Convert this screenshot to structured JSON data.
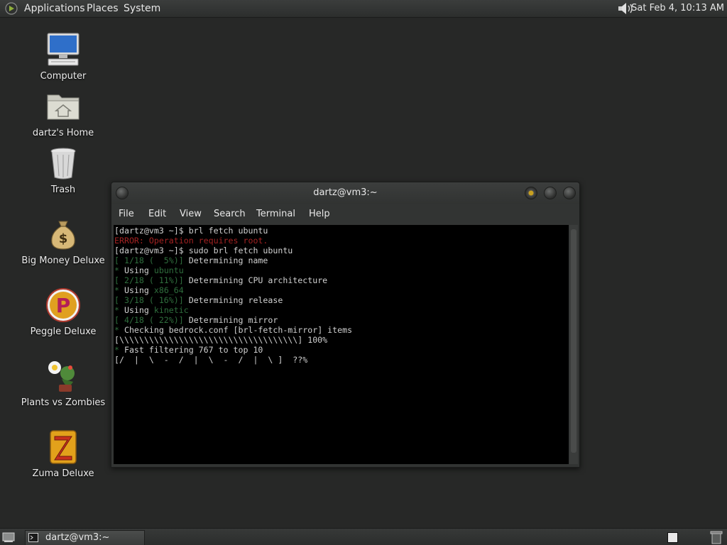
{
  "top_panel": {
    "menus": [
      "Applications",
      "Places",
      "System"
    ],
    "clock": "Sat Feb  4, 10:13 AM"
  },
  "desktop_icons": [
    {
      "label": "Computer",
      "icon": "computer-icon"
    },
    {
      "label": "dartz's Home",
      "icon": "home-folder-icon"
    },
    {
      "label": "Trash",
      "icon": "trash-icon"
    },
    {
      "label": "Big Money Deluxe",
      "icon": "money-bag-icon"
    },
    {
      "label": "Peggle Deluxe",
      "icon": "peggle-icon"
    },
    {
      "label": "Plants vs Zombies",
      "icon": "plants-vs-zombies-icon"
    },
    {
      "label": "Zuma Deluxe",
      "icon": "zuma-icon"
    }
  ],
  "terminal": {
    "title": "dartz@vm3:~",
    "menu": [
      "File",
      "Edit",
      "View",
      "Search",
      "Terminal",
      "Help"
    ],
    "lines": [
      [
        {
          "t": "[dartz@vm3 ~]$ brl fetch ubuntu",
          "c": "#d0d0d0"
        }
      ],
      [
        {
          "t": "ERROR: Operation requires root.",
          "c": "#a32222"
        }
      ],
      [
        {
          "t": "[dartz@vm3 ~]$ sudo brl fetch ubuntu",
          "c": "#d0d0d0"
        }
      ],
      [
        {
          "t": "[ 1/18 (  5%)]",
          "c": "#2f6e3d"
        },
        {
          "t": " Determining name",
          "c": "#d0d0d0"
        }
      ],
      [
        {
          "t": "* ",
          "c": "#2f6e3d"
        },
        {
          "t": "Using ",
          "c": "#d0d0d0"
        },
        {
          "t": "ubuntu",
          "c": "#2f6e3d"
        }
      ],
      [
        {
          "t": "[ 2/18 ( 11%)]",
          "c": "#2f6e3d"
        },
        {
          "t": " Determining CPU architecture",
          "c": "#d0d0d0"
        }
      ],
      [
        {
          "t": "* ",
          "c": "#2f6e3d"
        },
        {
          "t": "Using ",
          "c": "#d0d0d0"
        },
        {
          "t": "x86_64",
          "c": "#2f6e3d"
        }
      ],
      [
        {
          "t": "[ 3/18 ( 16%)]",
          "c": "#2f6e3d"
        },
        {
          "t": " Determining release",
          "c": "#d0d0d0"
        }
      ],
      [
        {
          "t": "* ",
          "c": "#2f6e3d"
        },
        {
          "t": "Using ",
          "c": "#d0d0d0"
        },
        {
          "t": "kinetic",
          "c": "#2f6e3d"
        }
      ],
      [
        {
          "t": "[ 4/18 ( 22%)]",
          "c": "#2f6e3d"
        },
        {
          "t": " Determining mirror",
          "c": "#d0d0d0"
        }
      ],
      [
        {
          "t": "* ",
          "c": "#2f6e3d"
        },
        {
          "t": "Checking bedrock.conf [brl-fetch-mirror] items",
          "c": "#d0d0d0"
        }
      ],
      [
        {
          "t": "[\\\\\\\\\\\\\\\\\\\\\\\\\\\\\\\\\\\\\\\\\\\\\\\\\\\\\\\\\\\\\\\\\\\\\\\\] 100%",
          "c": "#d0d0d0"
        }
      ],
      [
        {
          "t": "* ",
          "c": "#2f6e3d"
        },
        {
          "t": "Fast filtering 767 to top 10",
          "c": "#d0d0d0"
        }
      ],
      [
        {
          "t": "[/  |  \\  -  /  |  \\  -  /  |  \\ ]  ??%",
          "c": "#d0d0d0"
        }
      ]
    ]
  },
  "bottom_panel": {
    "task_label": "dartz@vm3:~"
  },
  "colors": {
    "desktop_bg": "#272827",
    "terminal_bg": "#000000",
    "error_red": "#a32222",
    "progress_green": "#2f6e3d"
  }
}
